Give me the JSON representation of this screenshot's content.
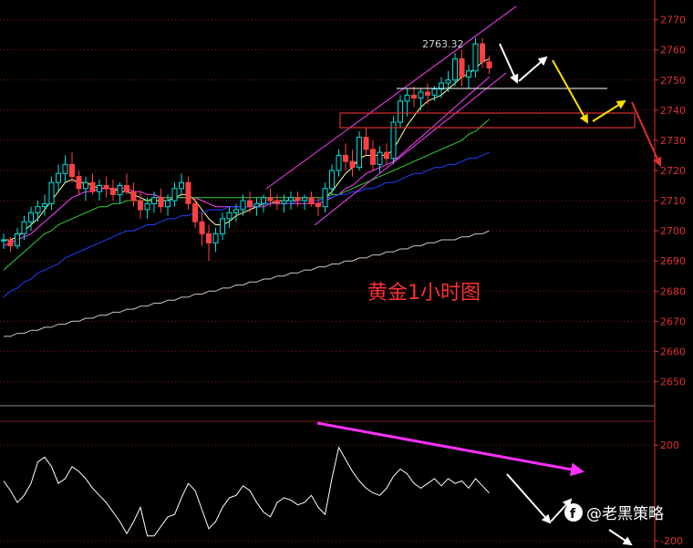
{
  "chart_data": [
    {
      "type": "candlestick",
      "title": "黄金1小时图",
      "ylim": [
        2645,
        2772
      ],
      "yticks": [
        2650,
        2660,
        2670,
        2680,
        2690,
        2700,
        2710,
        2720,
        2730,
        2740,
        2750,
        2760,
        2770
      ],
      "annotation": "2763.32",
      "candles": [
        [
          2697,
          2699,
          2694,
          2697
        ],
        [
          2697,
          2698,
          2693,
          2695
        ],
        [
          2695,
          2701,
          2694,
          2699
        ],
        [
          2699,
          2705,
          2697,
          2703
        ],
        [
          2703,
          2708,
          2700,
          2706
        ],
        [
          2706,
          2710,
          2703,
          2708
        ],
        [
          2708,
          2712,
          2705,
          2709
        ],
        [
          2709,
          2718,
          2707,
          2716
        ],
        [
          2716,
          2722,
          2713,
          2719
        ],
        [
          2719,
          2725,
          2716,
          2722
        ],
        [
          2722,
          2726,
          2716,
          2718
        ],
        [
          2718,
          2720,
          2712,
          2714
        ],
        [
          2714,
          2718,
          2710,
          2716
        ],
        [
          2716,
          2719,
          2712,
          2713
        ],
        [
          2713,
          2717,
          2710,
          2715
        ],
        [
          2715,
          2718,
          2711,
          2714
        ],
        [
          2714,
          2717,
          2710,
          2712
        ],
        [
          2712,
          2716,
          2709,
          2715
        ],
        [
          2715,
          2719,
          2712,
          2713
        ],
        [
          2713,
          2716,
          2708,
          2710
        ],
        [
          2710,
          2713,
          2704,
          2707
        ],
        [
          2707,
          2711,
          2704,
          2709
        ],
        [
          2709,
          2713,
          2706,
          2711
        ],
        [
          2711,
          2714,
          2706,
          2708
        ],
        [
          2708,
          2712,
          2705,
          2710
        ],
        [
          2710,
          2716,
          2708,
          2714
        ],
        [
          2714,
          2719,
          2712,
          2716
        ],
        [
          2716,
          2718,
          2707,
          2709
        ],
        [
          2709,
          2711,
          2701,
          2703
        ],
        [
          2703,
          2706,
          2695,
          2699
        ],
        [
          2699,
          2702,
          2690,
          2696
        ],
        [
          2696,
          2701,
          2693,
          2699
        ],
        [
          2699,
          2706,
          2697,
          2704
        ],
        [
          2704,
          2708,
          2701,
          2706
        ],
        [
          2706,
          2709,
          2703,
          2707
        ],
        [
          2707,
          2712,
          2705,
          2710
        ],
        [
          2710,
          2713,
          2706,
          2708
        ],
        [
          2708,
          2711,
          2705,
          2709
        ],
        [
          2709,
          2712,
          2706,
          2711
        ],
        [
          2711,
          2714,
          2708,
          2710
        ],
        [
          2710,
          2712,
          2707,
          2709
        ],
        [
          2709,
          2712,
          2706,
          2710
        ],
        [
          2710,
          2713,
          2707,
          2711
        ],
        [
          2711,
          2713,
          2708,
          2710
        ],
        [
          2710,
          2712,
          2707,
          2711
        ],
        [
          2711,
          2713,
          2708,
          2709
        ],
        [
          2709,
          2711,
          2705,
          2708
        ],
        [
          2708,
          2716,
          2706,
          2714
        ],
        [
          2714,
          2722,
          2712,
          2720
        ],
        [
          2720,
          2727,
          2718,
          2725
        ],
        [
          2725,
          2729,
          2720,
          2723
        ],
        [
          2723,
          2727,
          2718,
          2721
        ],
        [
          2721,
          2733,
          2720,
          2731
        ],
        [
          2731,
          2734,
          2725,
          2727
        ],
        [
          2727,
          2730,
          2720,
          2722
        ],
        [
          2722,
          2728,
          2719,
          2726
        ],
        [
          2726,
          2729,
          2722,
          2724
        ],
        [
          2724,
          2738,
          2722,
          2736
        ],
        [
          2736,
          2745,
          2734,
          2743
        ],
        [
          2743,
          2747,
          2738,
          2745
        ],
        [
          2745,
          2748,
          2741,
          2744
        ],
        [
          2744,
          2747,
          2740,
          2746
        ],
        [
          2746,
          2749,
          2742,
          2745
        ],
        [
          2745,
          2748,
          2743,
          2747
        ],
        [
          2747,
          2751,
          2744,
          2749
        ],
        [
          2749,
          2753,
          2746,
          2750
        ],
        [
          2750,
          2759,
          2748,
          2757
        ],
        [
          2757,
          2760,
          2748,
          2751
        ],
        [
          2751,
          2755,
          2747,
          2753
        ],
        [
          2753,
          2764,
          2751,
          2762
        ],
        [
          2762,
          2764,
          2754,
          2756
        ],
        [
          2756,
          2758,
          2752,
          2754
        ]
      ],
      "series": [
        {
          "values": [
            2697,
            2697,
            2698,
            2700,
            2702,
            2704,
            2707,
            2710,
            2713,
            2716,
            2717,
            2716,
            2716,
            2715,
            2714,
            2714,
            2714,
            2713,
            2713,
            2712,
            2711,
            2710,
            2710,
            2710,
            2710,
            2711,
            2712,
            2712,
            2710,
            2707,
            2704,
            2702,
            2702,
            2703,
            2705,
            2706,
            2707,
            2708,
            2709,
            2709,
            2710,
            2710,
            2710,
            2710,
            2710,
            2710,
            2710,
            2711,
            2713,
            2716,
            2719,
            2721,
            2724,
            2725,
            2725,
            2725,
            2725,
            2727,
            2731,
            2735,
            2738,
            2741,
            2743,
            2744,
            2745,
            2747,
            2749,
            2751,
            2752,
            2754,
            2756,
            2757
          ],
          "color": "#ffffa0"
        },
        {
          "values": [
            2695,
            2696,
            2697,
            2698,
            2699,
            2701,
            2703,
            2705,
            2707,
            2709,
            2711,
            2712,
            2713,
            2713,
            2714,
            2714,
            2714,
            2714,
            2714,
            2713,
            2713,
            2712,
            2712,
            2711,
            2711,
            2711,
            2711,
            2711,
            2711,
            2710,
            2709,
            2708,
            2708,
            2708,
            2708,
            2708,
            2708,
            2708,
            2708,
            2709,
            2709,
            2709,
            2709,
            2709,
            2709,
            2709,
            2709,
            2710,
            2711,
            2712,
            2714,
            2715,
            2717,
            2719,
            2720,
            2721,
            2722,
            2723,
            2725,
            2727,
            2729,
            2731,
            2733,
            2735,
            2737,
            2739,
            2741,
            2743,
            2745,
            2747,
            2749,
            2751
          ],
          "color": "#ff40ff"
        },
        {
          "values": [
            2687,
            2689,
            2691,
            2693,
            2695,
            2697,
            2699,
            2700,
            2702,
            2703,
            2704,
            2705,
            2706,
            2707,
            2708,
            2708,
            2709,
            2709,
            2710,
            2710,
            2710,
            2710,
            2711,
            2711,
            2711,
            2711,
            2711,
            2711,
            2711,
            2711,
            2711,
            2711,
            2711,
            2711,
            2711,
            2711,
            2711,
            2711,
            2711,
            2711,
            2711,
            2711,
            2711,
            2711,
            2711,
            2711,
            2711,
            2711,
            2712,
            2712,
            2713,
            2714,
            2715,
            2716,
            2717,
            2718,
            2719,
            2720,
            2721,
            2722,
            2723,
            2724,
            2725,
            2726,
            2727,
            2728,
            2729,
            2730,
            2732,
            2733,
            2735,
            2737
          ],
          "color": "#30d030"
        },
        {
          "values": [
            2678,
            2680,
            2681,
            2683,
            2684,
            2686,
            2687,
            2688,
            2689,
            2691,
            2692,
            2693,
            2694,
            2695,
            2696,
            2697,
            2698,
            2699,
            2700,
            2700,
            2701,
            2702,
            2702,
            2703,
            2704,
            2704,
            2705,
            2705,
            2706,
            2706,
            2707,
            2707,
            2707,
            2708,
            2708,
            2708,
            2708,
            2709,
            2709,
            2709,
            2709,
            2709,
            2709,
            2710,
            2710,
            2710,
            2710,
            2711,
            2711,
            2712,
            2712,
            2713,
            2713,
            2714,
            2714,
            2715,
            2716,
            2716,
            2717,
            2718,
            2719,
            2719,
            2720,
            2721,
            2721,
            2722,
            2722,
            2723,
            2724,
            2724,
            2725,
            2726
          ],
          "color": "#2040ff"
        },
        {
          "values": [
            2665,
            2665,
            2666,
            2666,
            2667,
            2667,
            2668,
            2668,
            2669,
            2669,
            2670,
            2670,
            2671,
            2671,
            2672,
            2672,
            2673,
            2673,
            2674,
            2674,
            2675,
            2675,
            2676,
            2676,
            2677,
            2677,
            2678,
            2678,
            2679,
            2679,
            2680,
            2680,
            2681,
            2681,
            2682,
            2682,
            2683,
            2683,
            2684,
            2684,
            2685,
            2685,
            2686,
            2686,
            2687,
            2687,
            2688,
            2688,
            2689,
            2689,
            2690,
            2690,
            2691,
            2691,
            2692,
            2692,
            2693,
            2693,
            2694,
            2694,
            2695,
            2695,
            2696,
            2696,
            2697,
            2697,
            2697,
            2698,
            2698,
            2699,
            2699,
            2700
          ],
          "color": "#c8c8c8"
        }
      ]
    },
    {
      "type": "line",
      "ylim": [
        -215,
        300
      ],
      "yticks": [
        -200,
        200
      ],
      "series": [
        {
          "values": [
            50,
            10,
            -40,
            -10,
            40,
            130,
            150,
            110,
            40,
            60,
            110,
            90,
            60,
            20,
            -10,
            -40,
            -80,
            -120,
            -170,
            -120,
            -60,
            -180,
            -180,
            -140,
            -100,
            -90,
            -20,
            40,
            10,
            -70,
            -150,
            -120,
            -60,
            -20,
            -10,
            30,
            10,
            -40,
            -80,
            -100,
            -40,
            -20,
            -30,
            -50,
            -40,
            -10,
            -60,
            -90,
            60,
            190,
            140,
            90,
            50,
            20,
            0,
            -10,
            20,
            70,
            100,
            80,
            40,
            20,
            40,
            60,
            30,
            60,
            40,
            50,
            20,
            60,
            30,
            0
          ],
          "color": "#ffffff"
        }
      ]
    }
  ],
  "watermark": {
    "text": "@老黑策略",
    "icon": "facebook-icon"
  }
}
